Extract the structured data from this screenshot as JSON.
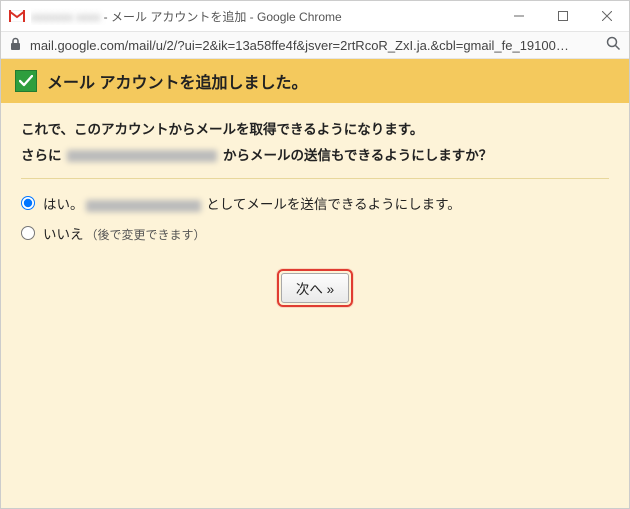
{
  "window": {
    "title_suffix": " - メール アカウントを追加 - Google Chrome"
  },
  "address": {
    "url": "mail.google.com/mail/u/2/?ui=2&ik=13a58ffe4f&jsver=2rtRcoR_ZxI.ja.&cbl=gmail_fe_19100…"
  },
  "header": {
    "title": "メール アカウントを追加しました。"
  },
  "intro": {
    "line1": "これで、このアカウントからメールを取得できるようになります。",
    "line2_prefix": "さらに ",
    "line2_suffix": " からメールの送信もできるようにしますか？"
  },
  "options": {
    "yes_prefix": "はい。",
    "yes_suffix": " としてメールを送信できるようにします。",
    "no": "いいえ",
    "no_note": "（後で変更できます）"
  },
  "buttons": {
    "next": "次へ »"
  }
}
